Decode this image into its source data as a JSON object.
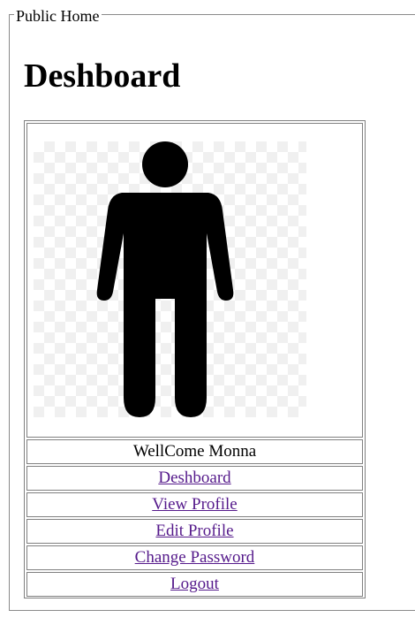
{
  "legend": "Public Home",
  "page_title": "Deshboard",
  "welcome_text": "WellCome Monna",
  "links": [
    {
      "label": "Deshboard"
    },
    {
      "label": "View Profile"
    },
    {
      "label": "Edit Profile"
    },
    {
      "label": "Change Password"
    },
    {
      "label": "Logout"
    }
  ],
  "colors": {
    "link": "#551a8b",
    "border": "#808080"
  },
  "profile_image_icon": "person-icon"
}
